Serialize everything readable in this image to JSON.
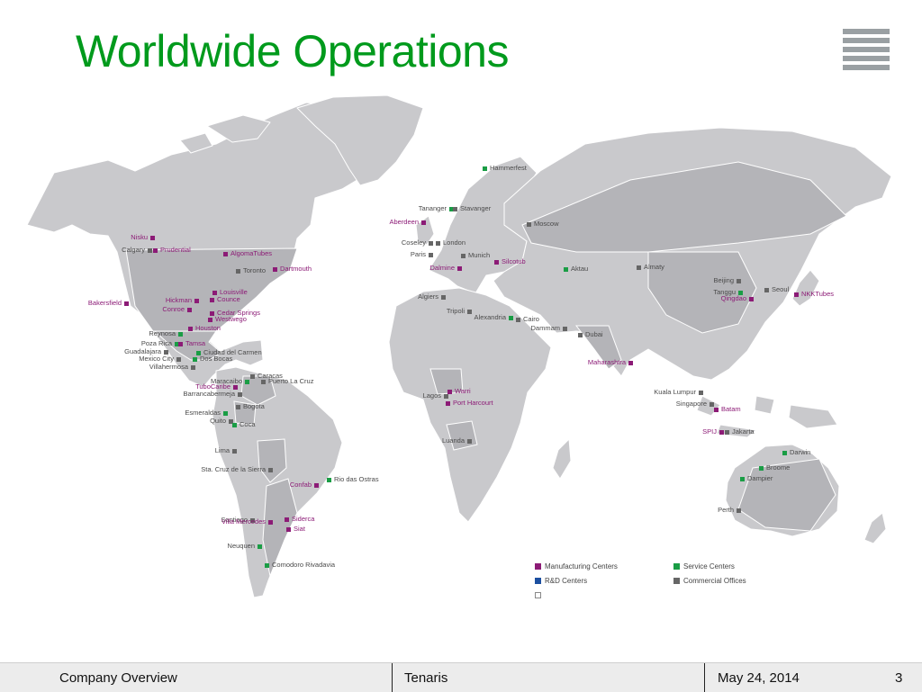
{
  "slide": {
    "title": "Worldwide Operations",
    "title_color": "#009a1c",
    "menu_icon": "hamburger-menu-icon"
  },
  "map": {
    "land_color": "#c9c9cc",
    "highlight_color": "#b4b4b8",
    "locations": [
      {
        "label": "Hammerfest",
        "type": "service"
      },
      {
        "label": "Tananger",
        "type": "service"
      },
      {
        "label": "Stavanger",
        "type": "commercial"
      },
      {
        "label": "Aberdeen",
        "type": "manufacturing"
      },
      {
        "label": "Moscow",
        "type": "commercial"
      },
      {
        "label": "Coseley",
        "type": "commercial"
      },
      {
        "label": "London",
        "type": "commercial"
      },
      {
        "label": "Paris",
        "type": "commercial"
      },
      {
        "label": "Munich",
        "type": "commercial"
      },
      {
        "label": "Silcotub",
        "type": "manufacturing"
      },
      {
        "label": "Dalmine",
        "type": "manufacturing"
      },
      {
        "label": "Aktau",
        "type": "service"
      },
      {
        "label": "Almaty",
        "type": "commercial"
      },
      {
        "label": "Beijing",
        "type": "commercial"
      },
      {
        "label": "Tanggu",
        "type": "service"
      },
      {
        "label": "Seoul",
        "type": "commercial"
      },
      {
        "label": "NKKTubes",
        "type": "manufacturing"
      },
      {
        "label": "Qingdao",
        "type": "manufacturing"
      },
      {
        "label": "Algiers",
        "type": "commercial"
      },
      {
        "label": "Tripoli",
        "type": "commercial"
      },
      {
        "label": "Alexandria",
        "type": "service"
      },
      {
        "label": "Cairo",
        "type": "commercial"
      },
      {
        "label": "Dammam",
        "type": "commercial"
      },
      {
        "label": "Dubai",
        "type": "commercial"
      },
      {
        "label": "Maharashtra",
        "type": "manufacturing"
      },
      {
        "label": "Kuala Lumpur",
        "type": "commercial"
      },
      {
        "label": "Singapore",
        "type": "commercial"
      },
      {
        "label": "Batam",
        "type": "manufacturing"
      },
      {
        "label": "SPIJ",
        "type": "manufacturing"
      },
      {
        "label": "Jakarta",
        "type": "commercial"
      },
      {
        "label": "Darwin",
        "type": "service"
      },
      {
        "label": "Broome",
        "type": "service"
      },
      {
        "label": "Dampier",
        "type": "service"
      },
      {
        "label": "Perth",
        "type": "commercial"
      },
      {
        "label": "Warri",
        "type": "manufacturing"
      },
      {
        "label": "Lagos",
        "type": "commercial"
      },
      {
        "label": "Port Harcourt",
        "type": "manufacturing"
      },
      {
        "label": "Luanda",
        "type": "commercial"
      },
      {
        "label": "Nisku",
        "type": "manufacturing"
      },
      {
        "label": "Calgary",
        "type": "commercial"
      },
      {
        "label": "Prudential",
        "type": "manufacturing"
      },
      {
        "label": "AlgomaTubes",
        "type": "manufacturing"
      },
      {
        "label": "Toronto",
        "type": "commercial"
      },
      {
        "label": "Dartmouth",
        "type": "manufacturing"
      },
      {
        "label": "Louisville",
        "type": "manufacturing"
      },
      {
        "label": "Counce",
        "type": "manufacturing"
      },
      {
        "label": "Hickman",
        "type": "manufacturing"
      },
      {
        "label": "Conroe",
        "type": "manufacturing"
      },
      {
        "label": "Bakersfield",
        "type": "manufacturing"
      },
      {
        "label": "Cedar Springs",
        "type": "manufacturing"
      },
      {
        "label": "Westwego",
        "type": "manufacturing"
      },
      {
        "label": "Houston",
        "type": "manufacturing"
      },
      {
        "label": "Reynosa",
        "type": "service"
      },
      {
        "label": "Poza Rica",
        "type": "service"
      },
      {
        "label": "Tamsa",
        "type": "manufacturing"
      },
      {
        "label": "Guadalajara",
        "type": "commercial"
      },
      {
        "label": "Ciudad del Carmen",
        "type": "service"
      },
      {
        "label": "Mexico City",
        "type": "commercial"
      },
      {
        "label": "Dos Bocas",
        "type": "service"
      },
      {
        "label": "Villahermosa",
        "type": "commercial"
      },
      {
        "label": "Maracaibo",
        "type": "service"
      },
      {
        "label": "Caracas",
        "type": "commercial"
      },
      {
        "label": "Puerto La Cruz",
        "type": "commercial"
      },
      {
        "label": "TuboCaribe",
        "type": "manufacturing"
      },
      {
        "label": "Barrancabermeja",
        "type": "commercial"
      },
      {
        "label": "Bogota",
        "type": "commercial"
      },
      {
        "label": "Esmeraldas",
        "type": "service"
      },
      {
        "label": "Quito",
        "type": "commercial"
      },
      {
        "label": "Coca",
        "type": "service"
      },
      {
        "label": "Lima",
        "type": "commercial"
      },
      {
        "label": "Sta. Cruz de la Sierra",
        "type": "commercial"
      },
      {
        "label": "Confab",
        "type": "manufacturing"
      },
      {
        "label": "Rio das Ostras",
        "type": "service"
      },
      {
        "label": "Santiago",
        "type": "commercial"
      },
      {
        "label": "Siderca",
        "type": "manufacturing"
      },
      {
        "label": "Villa Mercedes",
        "type": "manufacturing"
      },
      {
        "label": "Siat",
        "type": "manufacturing"
      },
      {
        "label": "Neuquen",
        "type": "service"
      },
      {
        "label": "Comodoro Rivadavia",
        "type": "service"
      }
    ]
  },
  "legend": {
    "manufacturing": {
      "label": "Manufacturing Centers",
      "color": "#8c1b76"
    },
    "service": {
      "label": "Service Centers",
      "color": "#1a9d45"
    },
    "rd": {
      "label": "R&D Centers",
      "color": "#1c4fa0"
    },
    "commercial": {
      "label": "Commercial Offices",
      "color": "#666666"
    },
    "empty": {
      "label": ""
    }
  },
  "footer": {
    "left": "Company Overview",
    "center": "Tenaris",
    "date": "May 24, 2014",
    "page": "3"
  }
}
